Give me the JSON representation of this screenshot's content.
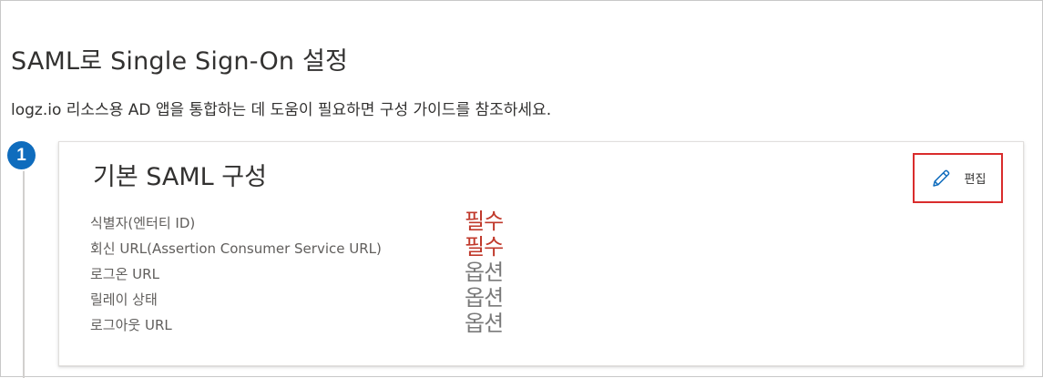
{
  "page": {
    "title": "SAML로 Single Sign-On 설정",
    "description_app": "logz.io",
    "description_rest": " 리소스용 AD 앱을 통합하는 데 도움이 필요하면 구성 가이드를 참조하세요."
  },
  "step": {
    "number": "1"
  },
  "card": {
    "title": "기본 SAML 구성",
    "edit_label": "편집",
    "edit_icon": "pencil-icon",
    "fields": [
      {
        "label": "식별자(엔터티 ID)",
        "value": "필수",
        "status": "required"
      },
      {
        "label": "회신 URL(Assertion Consumer Service URL)",
        "value": "필수",
        "status": "required"
      },
      {
        "label": "로그온 URL",
        "value": "옵션",
        "status": "optional"
      },
      {
        "label": "릴레이 상태",
        "value": "옵션",
        "status": "optional"
      },
      {
        "label": "로그아웃 URL",
        "value": "옵션",
        "status": "optional"
      }
    ]
  },
  "colors": {
    "accent": "#0f6cbd",
    "highlight_border": "#d92c2c",
    "required_text": "#c0392b",
    "optional_text": "#7a7a7a"
  }
}
